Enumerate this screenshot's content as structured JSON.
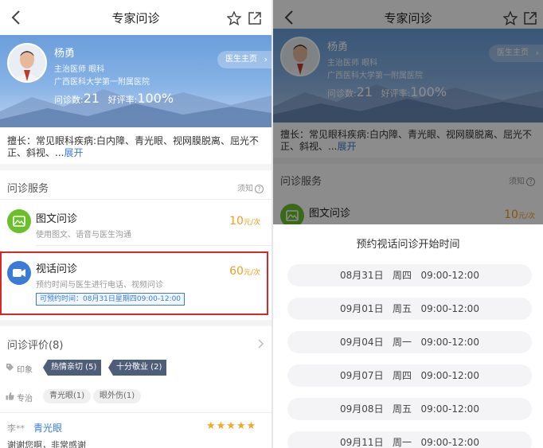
{
  "nav": {
    "title": "专家问诊"
  },
  "doctor": {
    "name": "杨勇",
    "title": "主治医师  眼科",
    "hospital": "广西医科大学第一附属医院",
    "consult_label": "问诊数:",
    "consult_count": "21",
    "rating_label": "好评率:",
    "rating_value": "100%",
    "home_button": "医生主页"
  },
  "specialty": {
    "text": "擅长：常见眼科疾病:白内障、青光眼、视网膜脱离、屈光不正、斜视、...",
    "expand": "展开"
  },
  "services": {
    "title": "问诊服务",
    "note": "须知",
    "items": [
      {
        "name": "图文问诊",
        "desc": "使用图文、语音与医生沟通",
        "price": "10",
        "unit": "元/次",
        "icon": "image-icon",
        "color": "#6abf2a"
      },
      {
        "name": "视话问诊",
        "desc": "预约时间与医生进行电话、视频问诊",
        "price": "60",
        "unit": "元/次",
        "icon": "video-camera-icon",
        "color": "#3a7bd5"
      }
    ],
    "slot_tag": "可预约时间：08月31日星期四09:00-12:00"
  },
  "reviews": {
    "title": "问诊评价(8)",
    "impression_label": "印象",
    "impressions": [
      "热情亲切 (5)",
      "十分敬业 (2)"
    ],
    "expertise_label": "专治",
    "expertise": [
      "青光眼(1)",
      "眼外伤(1)"
    ],
    "first": {
      "user": "李**",
      "tag": "青光眼",
      "stars": "★★★★★",
      "text": "谢谢您啊，非常感谢"
    }
  },
  "sheet": {
    "title": "预约视话问诊开始时间",
    "slots": [
      "08月31日   周四   09:00-12:00",
      "09月01日   周五   09:00-12:00",
      "09月04日   周一   09:00-12:00",
      "09月07日   周四   09:00-12:00",
      "09月08日   周五   09:00-12:00",
      "09月11日   周一   09:00-12:00"
    ]
  }
}
